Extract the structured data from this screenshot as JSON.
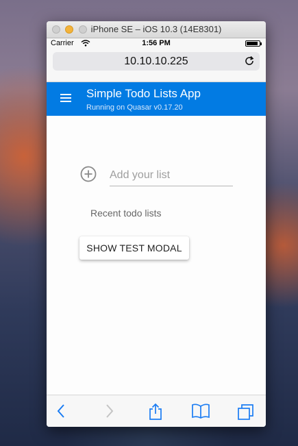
{
  "simulator": {
    "title": "iPhone SE – iOS 10.3 (14E8301)"
  },
  "status_bar": {
    "carrier": "Carrier",
    "time": "1:56 PM",
    "battery_level": 0.9
  },
  "browser": {
    "url": "10.10.10.225"
  },
  "app": {
    "title": "Simple Todo Lists App",
    "subtitle": "Running on Quasar v0.17.20",
    "accent_color": "#027be3"
  },
  "main": {
    "add_list_placeholder": "Add your list",
    "add_list_value": "",
    "recent_label": "Recent todo lists",
    "modal_button_label": "SHOW TEST MODAL"
  },
  "toolbar": {
    "icons": [
      "back-icon",
      "forward-icon",
      "share-icon",
      "bookmarks-icon",
      "tabs-icon"
    ],
    "icon_color": "#1a7cf3",
    "disabled_color": "#c4c4c4"
  }
}
